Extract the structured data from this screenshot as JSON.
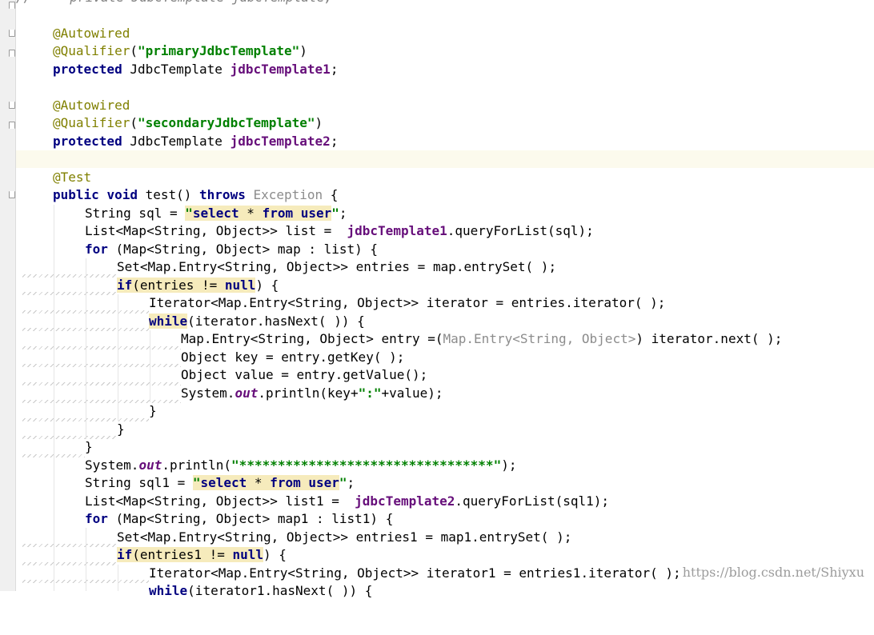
{
  "editor": {
    "comment_line": "//     private JdbcTemplate jdbcTemplate;",
    "annotation_autowired": "@Autowired",
    "annotation_qualifier": "@Qualifier",
    "annotation_test": "@Test",
    "kw_protected": "protected",
    "kw_public": "public",
    "kw_void": "void",
    "kw_throws": "throws",
    "kw_for": "for",
    "kw_if": "if",
    "kw_while": "while",
    "kw_null": "null",
    "primary_qualifier": "\"primaryJdbcTemplate\"",
    "secondary_qualifier": "\"secondaryJdbcTemplate\"",
    "type_jdbctemplate": "JdbcTemplate ",
    "field1": "jdbcTemplate1",
    "field2": "jdbcTemplate2",
    "method_name": " test() ",
    "exception_type": "Exception",
    "sql_open_quote": "\"",
    "sql_select": "select",
    "sql_star": " * ",
    "sql_from": "from",
    "sql_user": " user",
    "sql_close_quote": "\"",
    "stars_string": "\"*********************************\"",
    "colon_string": "\":\"",
    "out_field": "out",
    "line_sql_decl": "String sql = ",
    "line_sql1_decl": "String sql1 = ",
    "line_list_decl": "List<Map<String, Object>> list =  ",
    "line_list1_decl": "List<Map<String, Object>> list1 =  ",
    "query_call": ".queryForList(sql);",
    "query_call1": ".queryForList(sql1);",
    "for_rest": " (Map<String, Object> map : list) {",
    "for1_rest": " (Map<String, Object> map1 : list1) {",
    "set_line": "Set<Map.Entry<String, Object>> entries = map.entrySet( );",
    "set1_line": "Set<Map.Entry<String, Object>> entries1 = map1.entrySet( );",
    "if_var": "(entries != ",
    "if1_var": "(entries1 != ",
    "iterator_line": "Iterator<Map.Entry<String, Object>> iterator = entries.iterator( );",
    "iterator1_line": "Iterator<Map.Entry<String, Object>> iterator1 = entries1.iterator( );",
    "while_rest": "(iterator.hasNext( )) {",
    "while1_rest": "(iterator1.hasNext( )) {",
    "entry_line_a": "Map.Entry<String, Object> entry =(",
    "entry_line_cast": "Map.Entry<String, Object>",
    "entry_line_b": ") iterator.next( );",
    "key_line": "Object key = entry.getKey( );",
    "value_line": "Object value = entry.getValue();",
    "println_prefix": "System.",
    "println_key_mid": ".println(key+",
    "println_key_end": "+value);",
    "println_stars_end": ");",
    "close_brace": "}",
    "open_brace": " {",
    "semicolon": ";",
    "paren_close": ")"
  },
  "watermark": "https://blog.csdn.net/Shiyxu"
}
